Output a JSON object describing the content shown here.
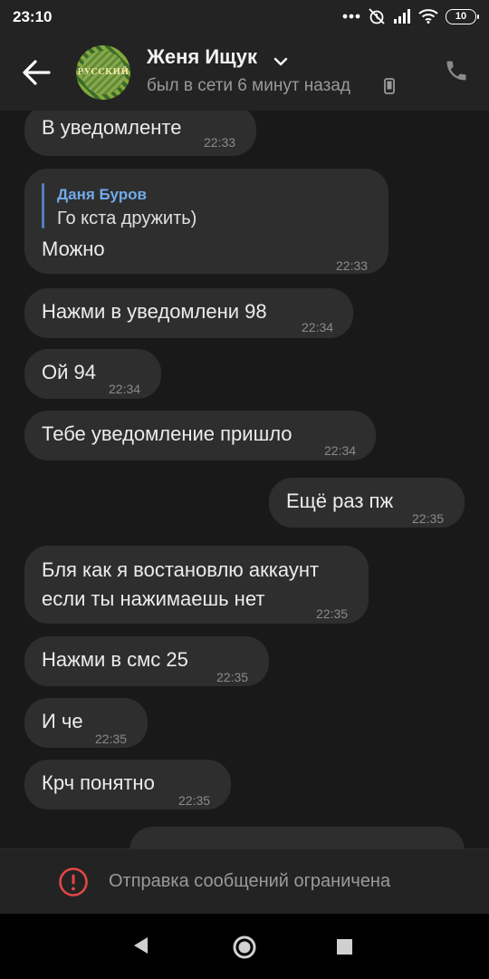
{
  "status_bar": {
    "time": "23:10",
    "battery": "10"
  },
  "header": {
    "contact_name": "Женя Ищук",
    "contact_status": "был в сети 6 минут назад",
    "avatar_text": "РУССКИЙ"
  },
  "messages": [
    {
      "text": "В уведомленте",
      "time": "22:33"
    },
    {
      "reply_author": "Даня Буров",
      "reply_text": "Го кста дружить)",
      "text": "Можно",
      "time": "22:33"
    },
    {
      "text": "Нажми в уведомлени 98",
      "time": "22:34"
    },
    {
      "text": "Ой 94",
      "time": "22:34"
    },
    {
      "text": "Тебе уведомление пришло",
      "time": "22:34"
    },
    {
      "text": "Ещё раз пж",
      "time": "22:35",
      "outgoing": true
    },
    {
      "line1": "Бля как я востановлю аккаунт",
      "line2": "если ты нажимаешь нет",
      "time": "22:35"
    },
    {
      "text": "Нажми в смс 25",
      "time": "22:35"
    },
    {
      "text": "И че",
      "time": "22:35"
    },
    {
      "text": "Крч понятно",
      "time": "22:35"
    }
  ],
  "restriction": {
    "text": "Отправка сообщений ограничена"
  },
  "colors": {
    "accent": "#71aaeb",
    "bubble": "#2e2e2e",
    "warning": "#e64646"
  }
}
